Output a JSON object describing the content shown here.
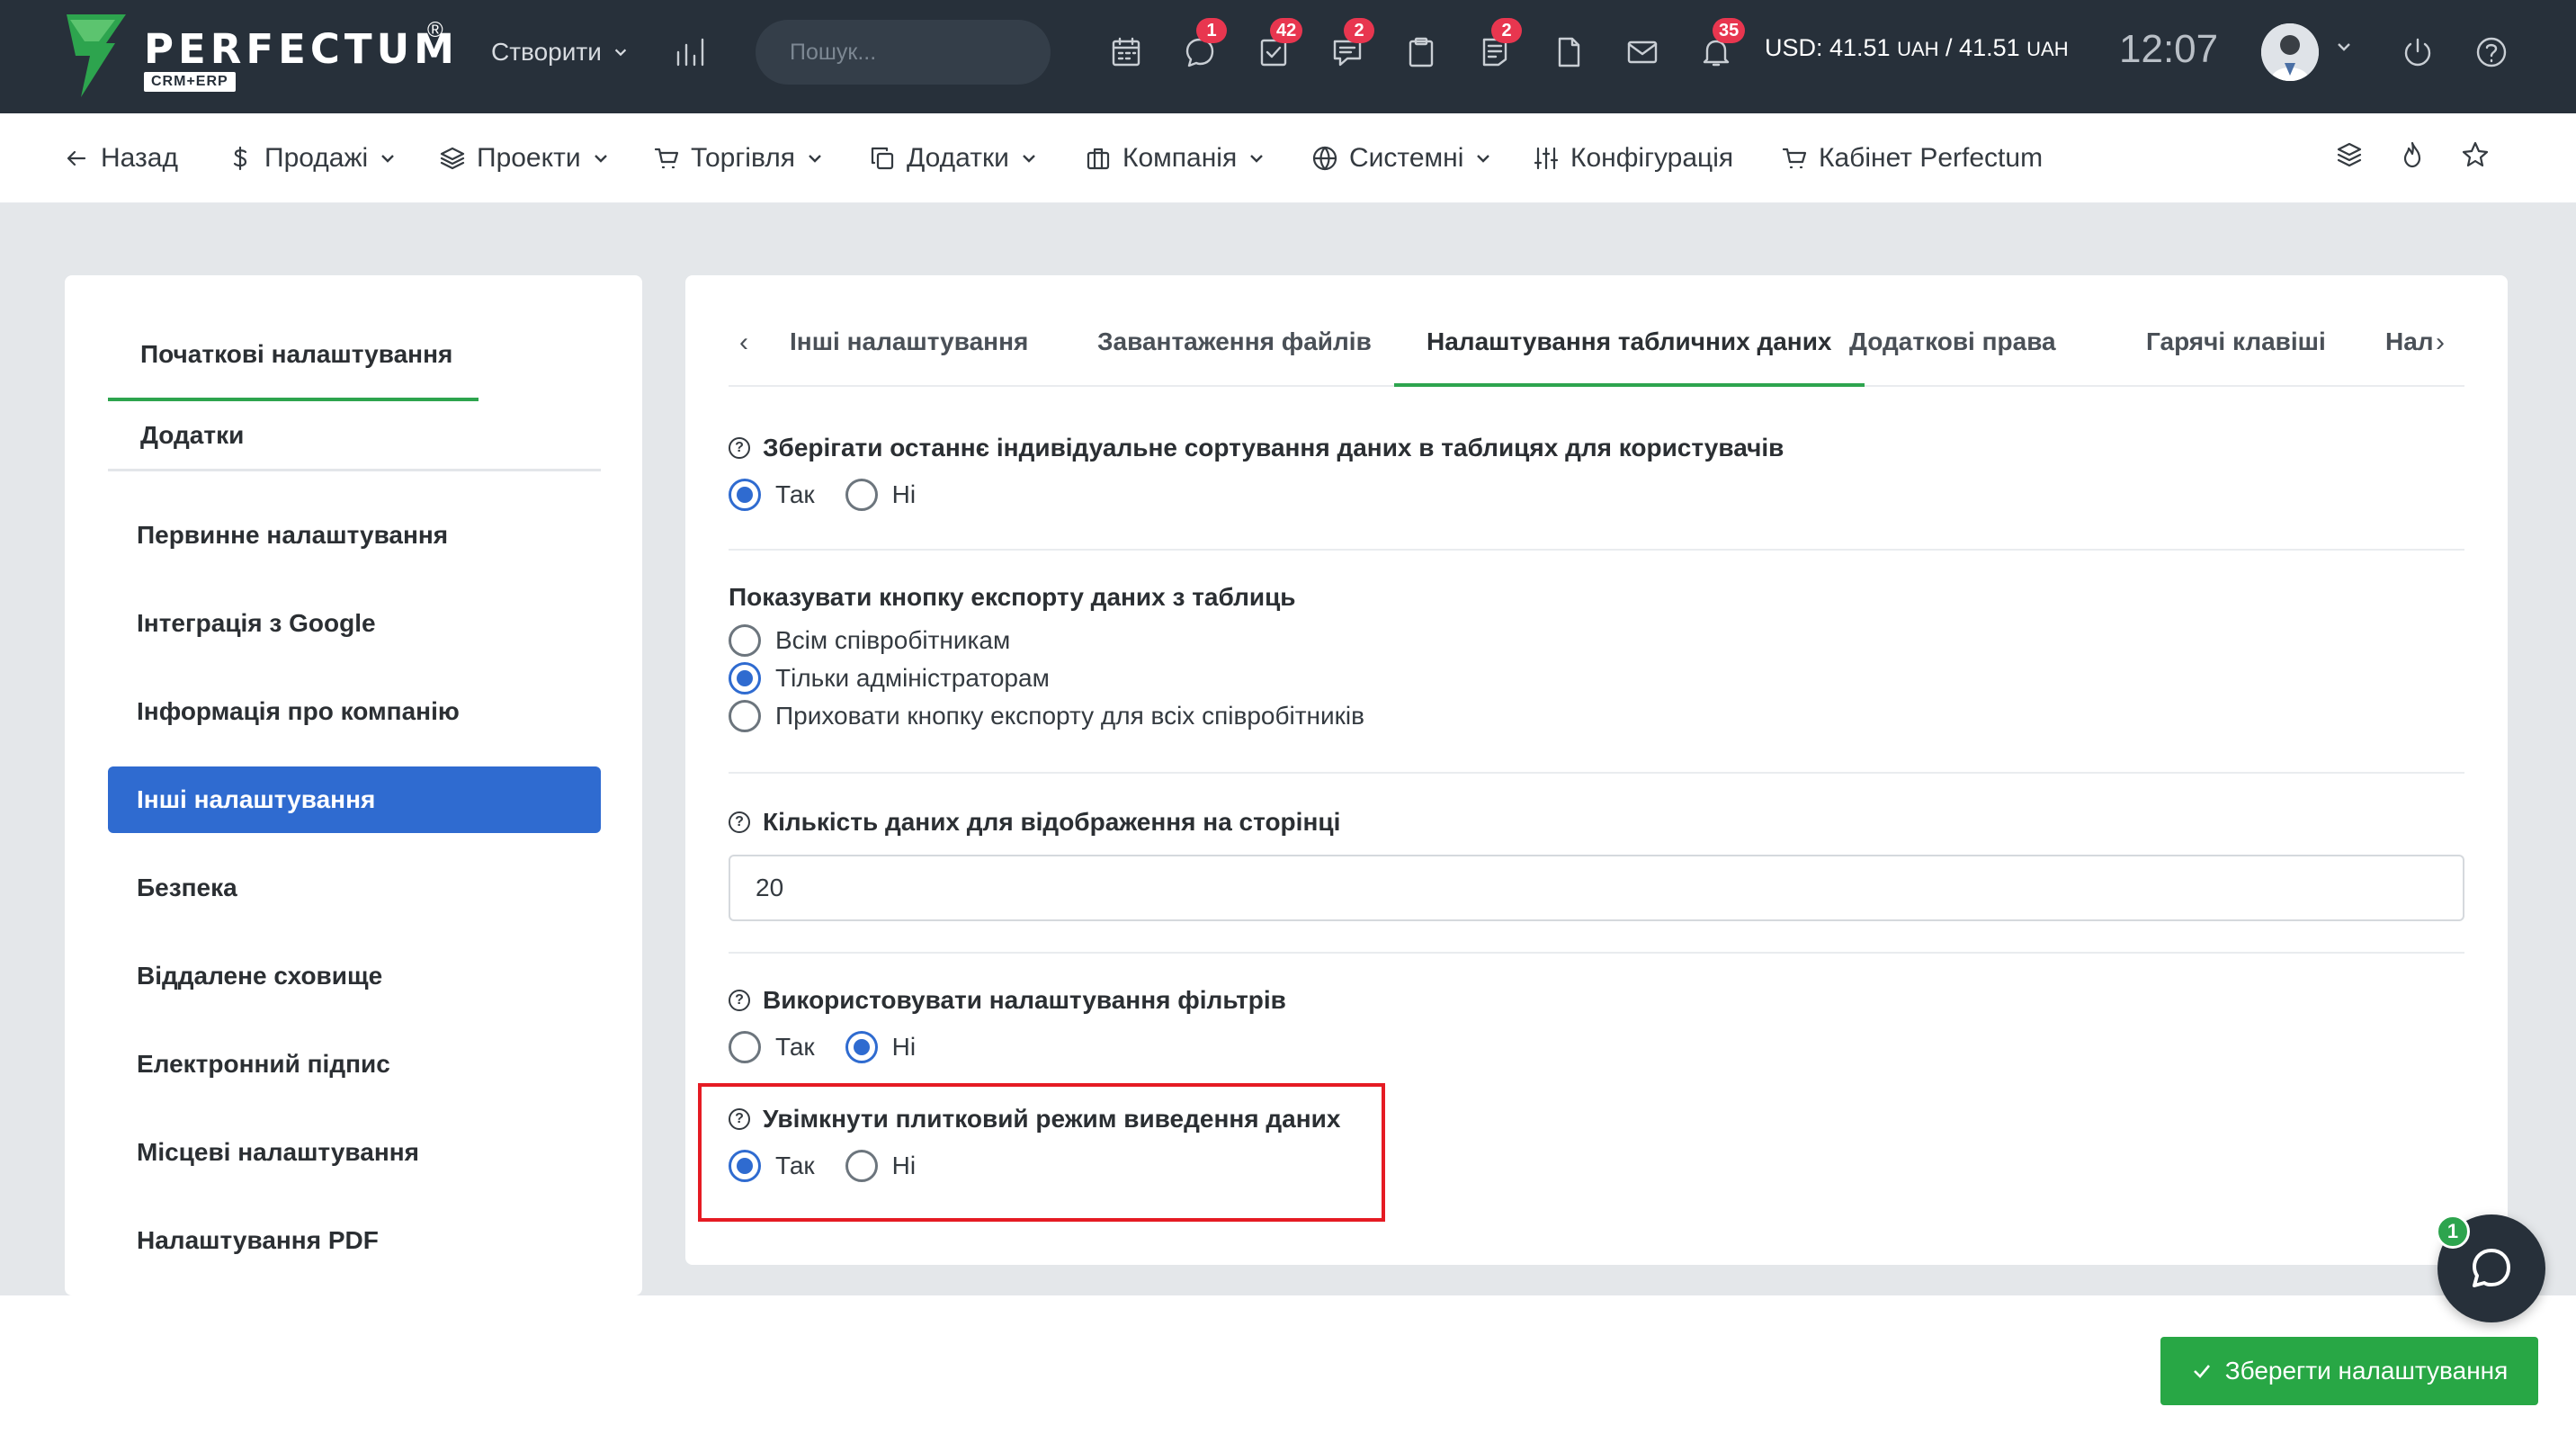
{
  "app": {
    "logo_text": "PERFECTUM",
    "logo_sub": "CRM+ERP",
    "logo_reg": "®"
  },
  "topbar": {
    "create_label": "Створити",
    "search_placeholder": "Пошук...",
    "icons": [
      {
        "name": "calendar-icon",
        "badge": ""
      },
      {
        "name": "chat-icon",
        "badge": "1"
      },
      {
        "name": "tasks-icon",
        "badge": "42"
      },
      {
        "name": "support-icon",
        "badge": "2"
      },
      {
        "name": "clipboard-icon",
        "badge": ""
      },
      {
        "name": "notes-icon",
        "badge": "2"
      },
      {
        "name": "document-icon",
        "badge": ""
      },
      {
        "name": "mail-icon",
        "badge": ""
      },
      {
        "name": "bell-icon",
        "badge": "35"
      }
    ],
    "currency_usd": "USD: 41.51",
    "currency_unit_1": "UAH",
    "currency_sep": " / 41.51",
    "currency_unit_2": "UAH",
    "time": "12:07"
  },
  "subnav": {
    "back": "Назад",
    "items": [
      {
        "label": "Продажі",
        "icon": "dollar-icon"
      },
      {
        "label": "Проекти",
        "icon": "layers-icon"
      },
      {
        "label": "Торгівля",
        "icon": "cart-icon"
      },
      {
        "label": "Додатки",
        "icon": "copy-icon"
      },
      {
        "label": "Компанія",
        "icon": "building-icon"
      },
      {
        "label": "Системні",
        "icon": "globe-icon"
      }
    ],
    "config": "Конфігурація",
    "cabinet": "Кабінет Perfectum"
  },
  "sidebar": {
    "tab_active": "Початкові налаштування",
    "tab_second": "Додатки",
    "items": [
      "Первинне налаштування",
      "Інтеграція з Google",
      "Інформація про компанію",
      "Інші налаштування",
      "Безпека",
      "Віддалене сховище",
      "Електронний підпис",
      "Місцеві налаштування",
      "Налаштування PDF"
    ],
    "active_index": 3
  },
  "tabs": {
    "items": [
      "Інші налаштування",
      "Завантаження файлів",
      "Налаштування табличних даних",
      "Додаткові права",
      "Гарячі клавіші",
      "Нал"
    ],
    "active_index": 2
  },
  "settings": {
    "sort": {
      "label": "Зберігати останнє індивідуальне сортування даних в таблицях для користувачів",
      "yes": "Так",
      "no": "Ні",
      "selected": "yes"
    },
    "export": {
      "label": "Показувати кнопку експорту даних з таблиць",
      "options": [
        "Всім співробітникам",
        "Тільки адміністраторам",
        "Приховати кнопку експорту для всіх співробітників"
      ],
      "selected_index": 1
    },
    "per_page": {
      "label": "Кількість даних для відображення на сторінці",
      "value": "20"
    },
    "filters": {
      "label": "Використовувати налаштування фільтрів",
      "yes": "Так",
      "no": "Ні",
      "selected": "no"
    },
    "tiles": {
      "label": "Увімкнути плитковий режим виведення даних",
      "yes": "Так",
      "no": "Ні",
      "selected": "yes"
    }
  },
  "footer": {
    "save_label": "Зберегти налаштування",
    "chat_badge": "1"
  },
  "colors": {
    "topbar_bg": "#27303a",
    "accent_green": "#2da44e",
    "accent_blue": "#2f6bd0",
    "badge_red": "#e8364f",
    "highlight_red": "#e51b23"
  }
}
